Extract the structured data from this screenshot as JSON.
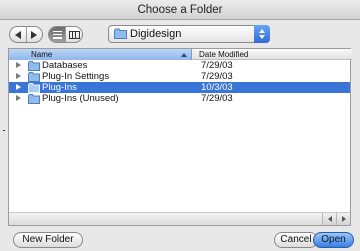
{
  "window": {
    "title": "Choose a Folder"
  },
  "toolbar": {
    "back_icon": "triangle-left",
    "forward_icon": "triangle-right",
    "list_view_icon": "list-view",
    "column_view_icon": "column-view",
    "location": "Digidesign"
  },
  "browser": {
    "columns": {
      "name": "Name",
      "date_modified": "Date Modified"
    },
    "sort": {
      "column": "name",
      "direction": "ascending"
    },
    "rows": [
      {
        "name": "Databases",
        "date": "7/29/03",
        "selected": false
      },
      {
        "name": "Plug-In Settings",
        "date": "7/29/03",
        "selected": false
      },
      {
        "name": "Plug-Ins",
        "date": "10/3/03",
        "selected": true
      },
      {
        "name": "Plug-Ins (Unused)",
        "date": "7/29/03",
        "selected": false
      }
    ]
  },
  "buttons": {
    "new_folder": "New Folder",
    "cancel": "Cancel",
    "open": "Open"
  },
  "colors": {
    "selection": "#3875d7",
    "name_header": "#a8c8f2",
    "open_button": "#5a98ea",
    "folder": "#7fb2e8"
  }
}
